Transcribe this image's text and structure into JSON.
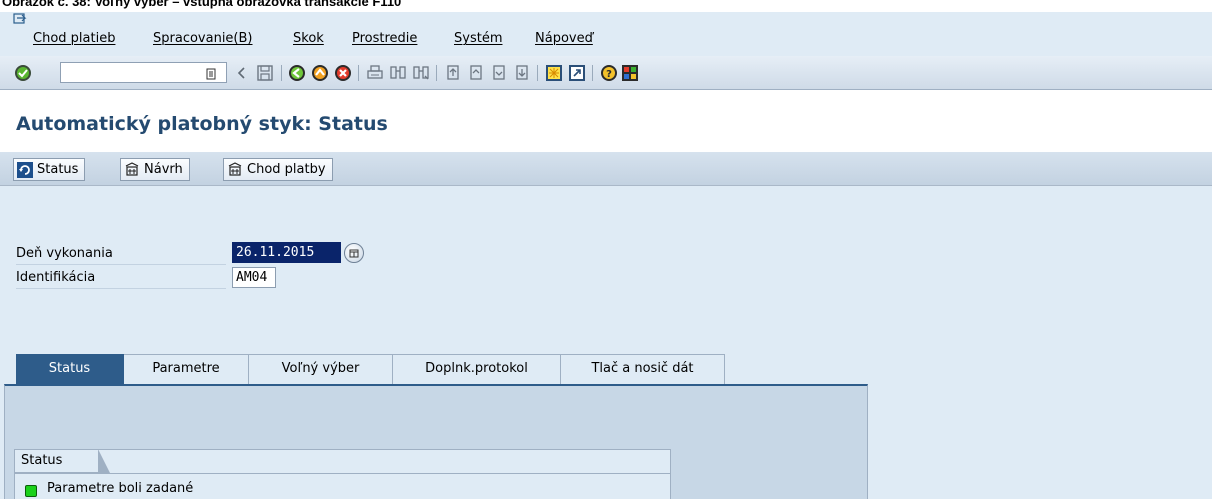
{
  "caption": "Obrázok č. 38: Voľný výber – vstupná obrazovka transakcie F110",
  "menu": {
    "items": [
      "Chod platieb",
      "Spracovanie(B)",
      "Skok",
      "Prostredie",
      "Systém",
      "Nápoveď"
    ]
  },
  "toolbar": {
    "command_field_value": "",
    "icons": [
      "enter-icon",
      "command-dropdown-icon",
      "back-arrow-icon",
      "save-icon",
      "back-icon",
      "exit-icon",
      "cancel-icon",
      "print-icon",
      "find-icon",
      "find-next-icon",
      "first-page-icon",
      "previous-page-icon",
      "next-page-icon",
      "last-page-icon",
      "new-session-icon",
      "shortcut-icon",
      "help-icon",
      "layout-icon"
    ]
  },
  "title": "Automatický platobný styk: Status",
  "app_toolbar": {
    "buttons": [
      "Status",
      "Návrh",
      "Chod platby"
    ]
  },
  "form": {
    "run_date_label": "Deň vykonania",
    "run_date_value": "26.11.2015",
    "identification_label": "Identifikácia",
    "identification_value": "AM04"
  },
  "tabs": [
    "Status",
    "Parametre",
    "Voľný výber",
    "Doplnk.protokol",
    "Tlač a nosič dát"
  ],
  "active_tab": "Status",
  "status_group": {
    "title": "Status",
    "message": "Parametre boli zadané",
    "led_color": "#1bd11b"
  },
  "colors": {
    "title": "#244a70",
    "active_tab": "#2e5c8a",
    "background": "#dfebf5"
  }
}
